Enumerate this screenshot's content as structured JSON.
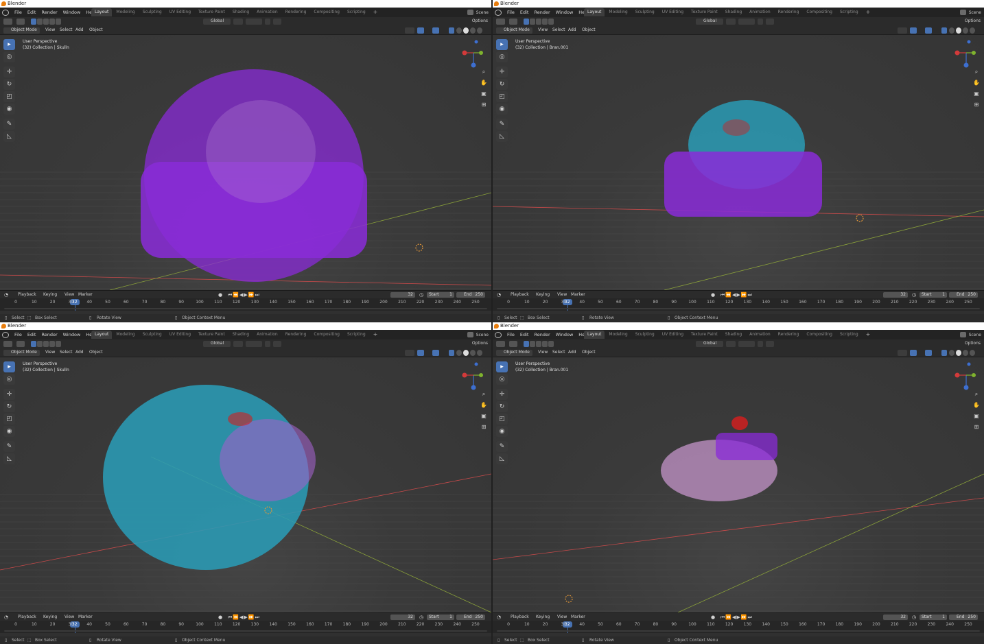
{
  "app": {
    "title": "Blender"
  },
  "menu": [
    "File",
    "Edit",
    "Render",
    "Window",
    "Help"
  ],
  "tabs": [
    "Layout",
    "Modeling",
    "Sculpting",
    "UV Editing",
    "Texture Paint",
    "Shading",
    "Animation",
    "Rendering",
    "Compositing",
    "Scripting"
  ],
  "active_tab": "Layout",
  "scene": {
    "label": "Scene"
  },
  "header": {
    "transform": "Global",
    "options": "Options"
  },
  "viewport_menu": {
    "mode": "Object Mode",
    "view": "View",
    "select": "Select",
    "add": "Add",
    "object": "Object"
  },
  "timeline": {
    "playback": "Playback",
    "keying": "Keying",
    "view": "View",
    "marker": "Marker",
    "current_frame": "32",
    "start_label": "Start",
    "start": "1",
    "end_label": "End",
    "end": "250",
    "ticks": [
      "0",
      "10",
      "20",
      "30",
      "40",
      "50",
      "60",
      "70",
      "80",
      "90",
      "100",
      "110",
      "120",
      "130",
      "140",
      "150",
      "160",
      "170",
      "180",
      "190",
      "200",
      "210",
      "220",
      "230",
      "240",
      "250"
    ]
  },
  "status": {
    "select": "Select",
    "box_select": "Box Select",
    "rotate_view": "Rotate View",
    "context_menu": "Object Context Menu"
  },
  "colors": {
    "accent": "#4772b3",
    "purple_mesh": "#8a2bd8",
    "cyan_mesh": "#2a9bb5",
    "red_mesh": "#d02020",
    "origin_ring": "#e0963a"
  },
  "icons": [
    "blender-logo-icon",
    "select-cursor-icon",
    "cursor-icon",
    "move-icon",
    "rotate-icon",
    "scale-icon",
    "transform-icon",
    "annotate-icon",
    "measure-icon",
    "zoom-icon",
    "hand-pan-icon",
    "camera-icon",
    "grid-icon",
    "scene-icon"
  ],
  "windows": [
    {
      "perspective": "User Perspective",
      "collection": "(32) Collection | Skulln"
    },
    {
      "perspective": "User Perspective",
      "collection": "(32) Collection | Bran.001"
    },
    {
      "perspective": "User Perspective",
      "collection": "(32) Collection | Skulln"
    },
    {
      "perspective": "User Perspective",
      "collection": "(32) Collection | Bran.001"
    }
  ]
}
